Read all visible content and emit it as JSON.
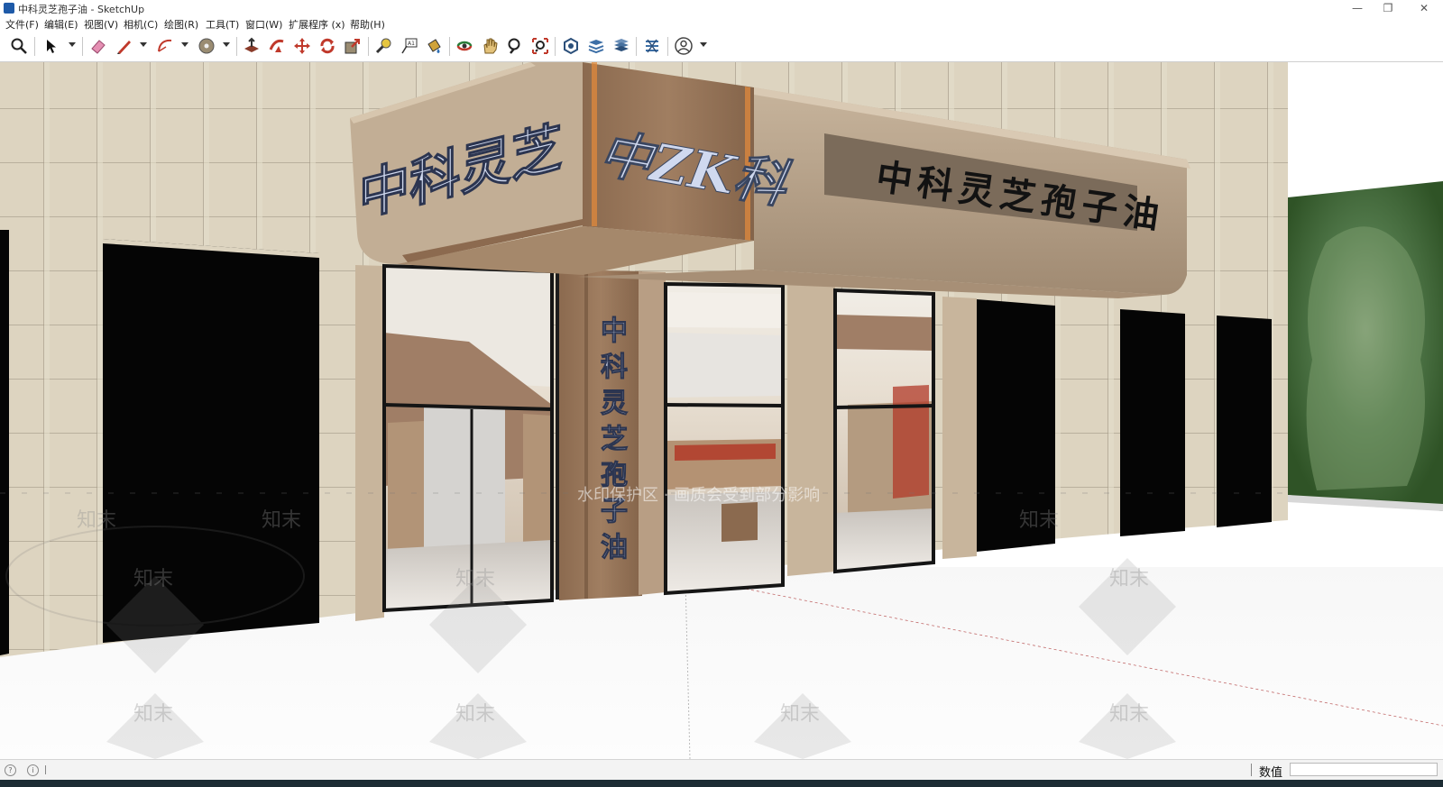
{
  "window": {
    "title": "中科灵芝孢子油 - SketchUp",
    "controls": [
      "—",
      "❐",
      "✕"
    ]
  },
  "menu": [
    "文件(F)",
    "编辑(E)",
    "视图(V)",
    "相机(C)",
    "绘图(R)",
    "工具(T)",
    "窗口(W)",
    "扩展程序 (x)",
    "帮助(H)"
  ],
  "toolbar": {
    "tools": [
      "zoom-extents-icon",
      "select-icon",
      "eraser-icon",
      "pencil-line-icon",
      "arc-icon",
      "paint-bucket-icon",
      "push-pull-icon",
      "follow-me-icon",
      "move-icon",
      "rotate-icon",
      "scale-icon",
      "tape-measure-icon",
      "text-icon",
      "paint-icon",
      "orbit-icon",
      "pan-icon",
      "zoom-icon",
      "zoom-window-icon",
      "components-icon",
      "layers-icon",
      "styles-icon",
      "scenes-icon",
      "account-icon"
    ]
  },
  "scene": {
    "canopy_sign": "中科灵芝",
    "logo_text": "中ZK科",
    "fascia_sign": "中科灵芝孢子油",
    "pillar_sign": "中科灵芝孢子油",
    "watermark_line": "水印保护区 · 画质会受到部分影响",
    "watermark_brand": "知末"
  },
  "status": {
    "vcb_label": "数值",
    "vcb_value": ""
  },
  "colors": {
    "wall": "#ddd3bf",
    "grid_line": "#a39a88",
    "canopy": "#b19d86",
    "wood": "#8c6a50",
    "sign_letters": "#d0d9ef",
    "black_window": "#050505",
    "tree_green": "#3f6a30"
  }
}
